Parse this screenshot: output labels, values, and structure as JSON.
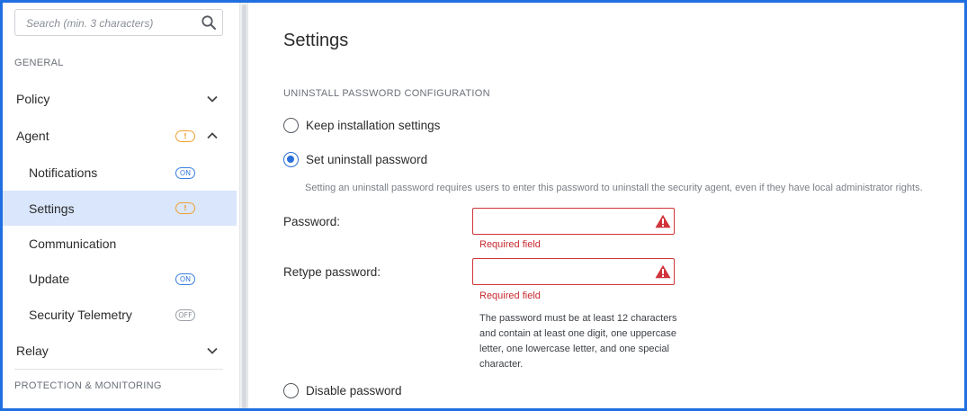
{
  "sidebar": {
    "search_placeholder": "Search (min. 3 characters)",
    "section_general": "GENERAL",
    "section_protection": "PROTECTION & MONITORING",
    "items": [
      {
        "label": "Policy"
      },
      {
        "label": "Agent",
        "badge": "!"
      },
      {
        "label": "Notifications",
        "badge": "ON"
      },
      {
        "label": "Settings",
        "badge": "!"
      },
      {
        "label": "Communication"
      },
      {
        "label": "Update",
        "badge": "ON"
      },
      {
        "label": "Security Telemetry",
        "badge": "OFF"
      },
      {
        "label": "Relay"
      }
    ]
  },
  "main": {
    "title": "Settings",
    "section_label": "UNINSTALL PASSWORD CONFIGURATION",
    "options": {
      "keep": "Keep installation settings",
      "set": "Set uninstall password",
      "disable": "Disable password"
    },
    "selected_option": "set",
    "hint": "Setting an uninstall password requires users to enter this password to uninstall the security agent, even if they have local administrator rights.",
    "password_label": "Password:",
    "password_value": "",
    "retype_label": "Retype password:",
    "retype_value": "",
    "required_error": "Required field",
    "password_rules": "The password must be at least 12 characters and contain at least one digit, one uppercase letter, one lowercase letter, and one special character."
  },
  "colors": {
    "accent": "#2a6fdb",
    "active_bg": "#d9e6fb",
    "error": "#c6292f",
    "warning": "#f0a030",
    "frame": "#1f6fe0"
  },
  "icons": {
    "search": "search-icon",
    "chevron_down": "chevron-down-icon",
    "chevron_up": "chevron-up-icon",
    "warning": "warning-triangle-icon"
  }
}
